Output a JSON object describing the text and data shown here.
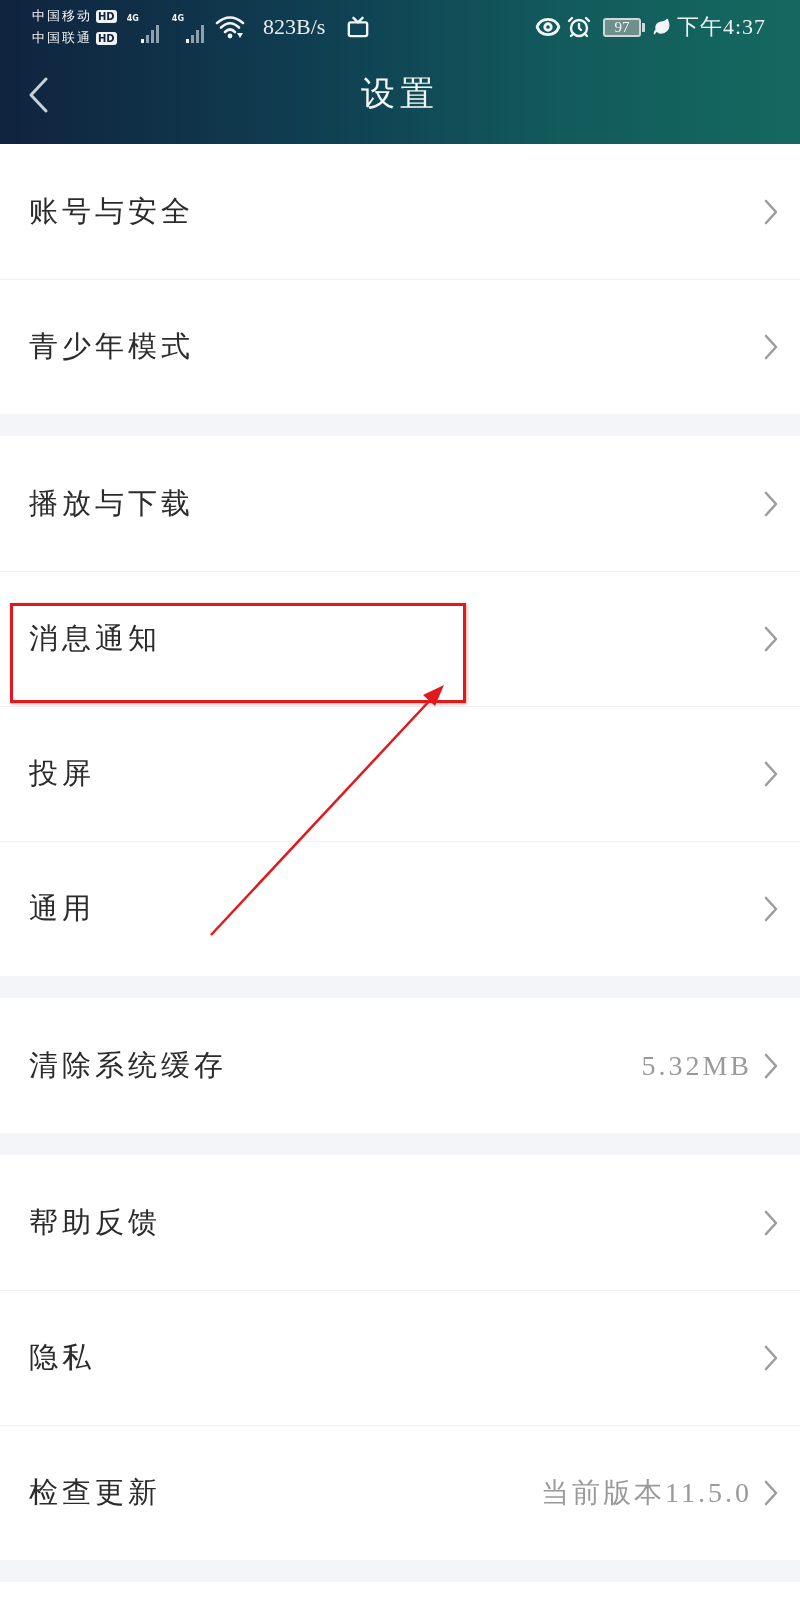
{
  "status_bar": {
    "carriers": [
      {
        "name": "中国移动",
        "badge": "HD"
      },
      {
        "name": "中国联通",
        "badge": "HD"
      }
    ],
    "signals": [
      {
        "label": "4G"
      },
      {
        "label": "4G"
      }
    ],
    "network_speed": "823B/s",
    "battery": "97",
    "time": "下午4:37"
  },
  "nav_bar": {
    "title": "设置"
  },
  "groups": [
    {
      "items": [
        {
          "label": "账号与安全",
          "annotated": false
        },
        {
          "label": "青少年模式",
          "annotated": false
        }
      ]
    },
    {
      "items": [
        {
          "label": "播放与下载",
          "annotated": false
        },
        {
          "label": "消息通知",
          "annotated": true
        },
        {
          "label": "投屏",
          "annotated": false
        },
        {
          "label": "通用",
          "annotated": false
        }
      ]
    },
    {
      "items": [
        {
          "label": "清除系统缓存",
          "value": "5.32MB",
          "annotated": false
        }
      ]
    },
    {
      "items": [
        {
          "label": "帮助反馈",
          "annotated": false
        },
        {
          "label": "隐私",
          "annotated": false
        },
        {
          "label": "检查更新",
          "value": "当前版本11.5.0",
          "annotated": false
        }
      ]
    }
  ]
}
